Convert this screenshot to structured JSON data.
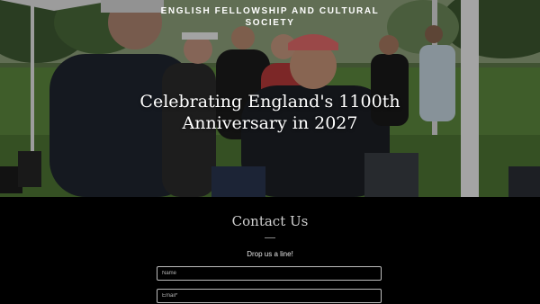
{
  "header": {
    "site_title": "ENGLISH FELLOWSHIP AND CULTURAL SOCIETY"
  },
  "hero": {
    "headline": "Celebrating England's 1100th Anniversary in 2027",
    "image": "outdoor-gathering-photo"
  },
  "contact": {
    "title": "Contact Us",
    "tagline": "Drop us a line!",
    "fields": {
      "name_placeholder": "Name",
      "email_placeholder": "Email*"
    }
  },
  "colors": {
    "background": "#000000",
    "text": "#ffffff",
    "field_border": "#bdbdbd"
  }
}
